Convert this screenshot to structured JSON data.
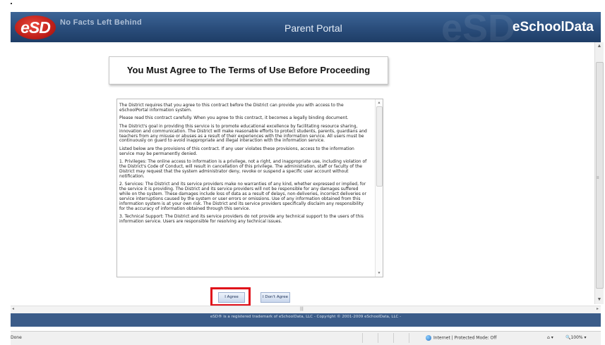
{
  "header": {
    "logo_text": "eSD",
    "tagline": "No Facts Left Behind",
    "portal_title": "Parent Portal",
    "brand": "eSchoolData"
  },
  "main": {
    "heading": "You Must Agree to The Terms of Use Before Proceeding",
    "terms_paragraphs": [
      "The District requires that you agree to this contract before the District can provide you with access to the eSchoolPortal information system.",
      "Please read this contract carefully. When you agree to this contract, it becomes a legally binding document.",
      "The District's goal in providing this service is to promote educational excellence by facilitating resource sharing, innovation and communication.  The District will make reasonable efforts to protect students, parents, guardians and teachers from any misuse or abuses as a result of their experiences with the information service.  All users must be continuously on guard to avoid inappropriate and illegal interaction with the information service.",
      "Listed below are the provisions of this contract.  If any user violates these provisions, access to the information service may be permanently denied.",
      "1. Privileges: The online access to information is a privilege, not a right, and inappropriate use, including violation of the District's Code of Conduct, will result in cancellation of this privilege.  The administration, staff or faculty of the District may request that the system administrator deny, revoke or suspend a specific user account without notification.",
      "2. Services: The District and its service providers make no warranties of any kind, whether expressed or implied, for the service it is providing.  The District and its service providers will not be responsible for any damages suffered while on the system. These damages include loss of data as a result of delays, non-deliveries, incorrect deliveries or service interruptions caused by the system or user errors or omissions.  Use of any information obtained from this information system is at your own risk.  The District and its service providers specifically disclaim any responsibility for the accuracy of information obtained through this service.",
      "3. Technical Support: The District and its service providers do not provide any technical support to the users of this information service.  Users are responsible for resolving any technical issues."
    ],
    "agree_label": "I Agree",
    "disagree_label": "I Don't Agree"
  },
  "footer": {
    "text": "eSD® is a registered trademark of eSchoolData, LLC - Copyright © 2001-2009 eSchoolData, LLC -"
  },
  "statusbar": {
    "status": "Done",
    "zone": "Internet | Protected Mode: Off",
    "zoom": "100%"
  },
  "colors": {
    "banner": "#2a4d7b",
    "footer": "#3b5c89",
    "highlight": "#e0101a"
  }
}
